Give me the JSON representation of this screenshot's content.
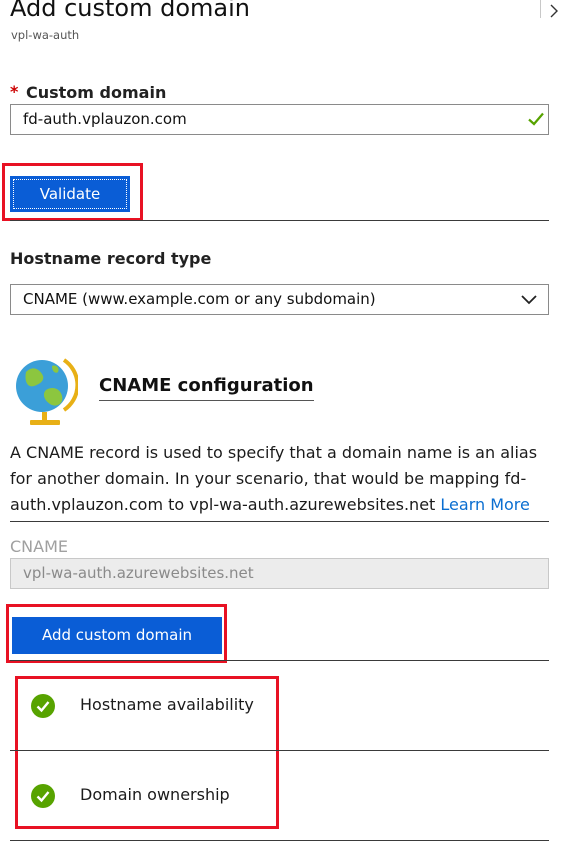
{
  "blade": {
    "title": "Add custom domain",
    "subtitle": "vpl-wa-auth",
    "close_icon": "chevron-right-icon"
  },
  "custom_domain": {
    "required_marker": "*",
    "label": "Custom domain",
    "value": "fd-auth.vplauzon.com",
    "valid": true,
    "valid_icon": "checkmark-icon"
  },
  "validate_button": {
    "label": "Validate"
  },
  "hostname_record": {
    "label": "Hostname record type",
    "selected": "CNAME (www.example.com or any subdomain)"
  },
  "cname_config": {
    "icon": "globe-icon",
    "heading": "CNAME configuration",
    "description": "A CNAME record is used to specify that a domain name is an alias for another domain. In your scenario, that would be mapping fd-auth.vplauzon.com to vpl-wa-auth.azurewebsites.net",
    "learn_more": "Learn More"
  },
  "cname_field": {
    "label": "CNAME",
    "value": "vpl-wa-auth.azurewebsites.net"
  },
  "add_button": {
    "label": "Add custom domain"
  },
  "checks": [
    {
      "label": "Hostname availability",
      "status": "success"
    },
    {
      "label": "Domain ownership",
      "status": "success"
    }
  ],
  "colors": {
    "accent": "#0a5dd6",
    "success": "#57a300",
    "highlight": "#e81123",
    "link": "#0a6ed1"
  }
}
